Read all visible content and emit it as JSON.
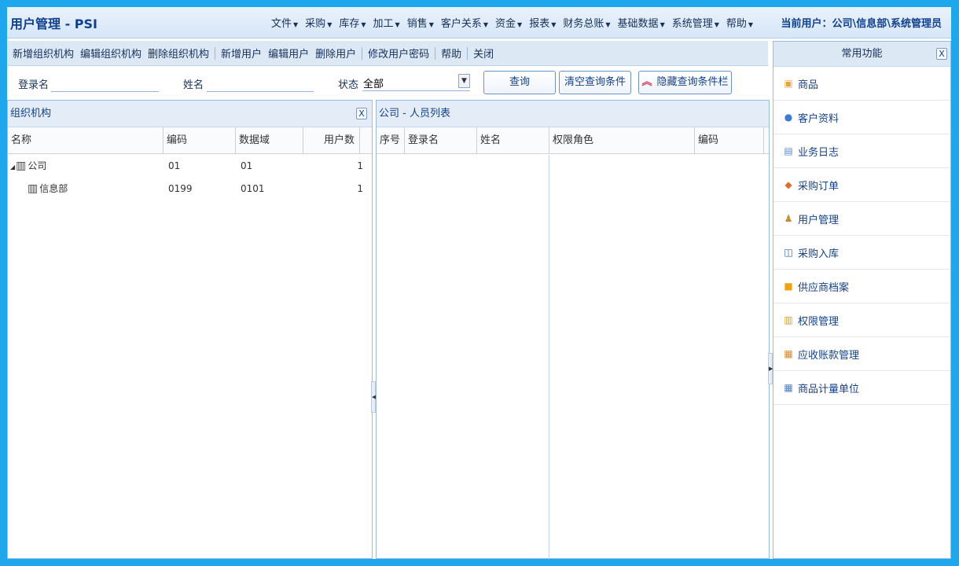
{
  "app": {
    "title": "用户管理 - PSI",
    "current_user": "当前用户：公司\\信息部\\系统管理员"
  },
  "menu": [
    {
      "label": "文件"
    },
    {
      "label": "采购"
    },
    {
      "label": "库存"
    },
    {
      "label": "加工"
    },
    {
      "label": "销售"
    },
    {
      "label": "客户关系"
    },
    {
      "label": "资金"
    },
    {
      "label": "报表"
    },
    {
      "label": "财务总账"
    },
    {
      "label": "基础数据"
    },
    {
      "label": "系统管理"
    },
    {
      "label": "帮助"
    }
  ],
  "toolbar": {
    "add_org": "新增组织机构",
    "edit_org": "编辑组织机构",
    "delete_org": "删除组织机构",
    "add_user": "新增用户",
    "edit_user": "编辑用户",
    "delete_user": "删除用户",
    "change_password": "修改用户密码",
    "help": "帮助",
    "close": "关闭"
  },
  "query": {
    "login_label": "登录名",
    "login_value": "",
    "name_label": "姓名",
    "name_value": "",
    "status_label": "状态",
    "status_value": "全部",
    "query_button": "查询",
    "clear_button": "清空查询条件",
    "hide_button": "隐藏查询条件栏"
  },
  "org_panel": {
    "title": "组织机构",
    "close": "X",
    "columns": [
      "名称",
      "编码",
      "数据域",
      "用户数"
    ],
    "rows": [
      {
        "name": "公司",
        "code": "01",
        "domain": "01",
        "count": "1"
      },
      {
        "name": "信息部",
        "code": "0199",
        "domain": "0101",
        "count": "1"
      }
    ]
  },
  "user_panel": {
    "title": "公司 - 人员列表",
    "columns": [
      "序号",
      "登录名",
      "姓名",
      "权限角色",
      "编码"
    ]
  },
  "sidebar": {
    "title": "常用功能",
    "close": "X",
    "items": [
      {
        "label": "商品",
        "icon": "product-icon",
        "color": "#e8a33d"
      },
      {
        "label": "客户资料",
        "icon": "customer-icon",
        "color": "#3a7bd5"
      },
      {
        "label": "业务日志",
        "icon": "log-icon",
        "color": "#5b8bd0"
      },
      {
        "label": "采购订单",
        "icon": "purchase-order-icon",
        "color": "#d9712b"
      },
      {
        "label": "用户管理",
        "icon": "user-management-icon",
        "color": "#c98a2a"
      },
      {
        "label": "采购入库",
        "icon": "purchase-inbound-icon",
        "color": "#2c5fa8"
      },
      {
        "label": "供应商档案",
        "icon": "supplier-icon",
        "color": "#f2a20c"
      },
      {
        "label": "权限管理",
        "icon": "permission-lock-icon",
        "color": "#c9a227"
      },
      {
        "label": "应收账款管理",
        "icon": "receivables-icon",
        "color": "#d88a2a"
      },
      {
        "label": "商品计量单位",
        "icon": "unit-icon",
        "color": "#4f7fc2"
      }
    ]
  }
}
